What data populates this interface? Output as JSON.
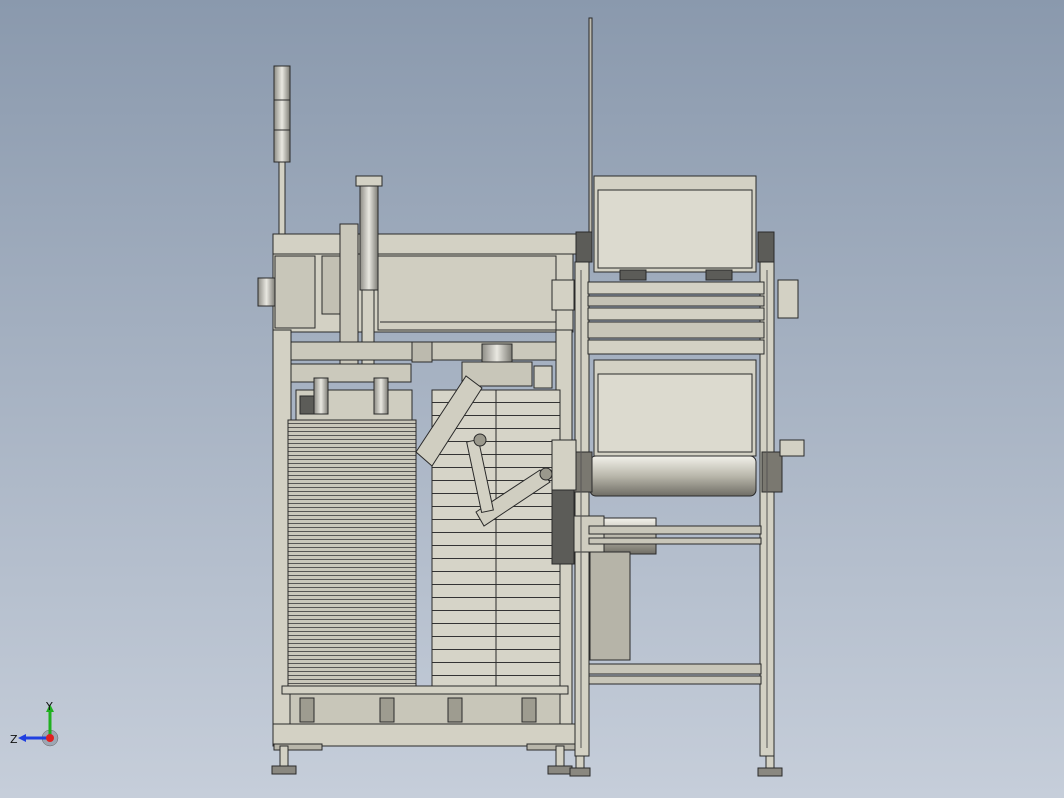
{
  "view": {
    "name": "cad-assembly-front-view",
    "colors": {
      "bg_top": "#8a99ad",
      "bg_bottom": "#c3cbd8",
      "metal": "#d3d1c4",
      "metal_dark": "#a9a79b",
      "line": "#2a2a2a",
      "dark_part": "#5c5c58",
      "axis_x": "#e02020",
      "axis_y": "#20b020",
      "axis_z": "#2040e0"
    }
  },
  "triad": {
    "x_label": "",
    "y_label": "Y",
    "z_label": "Z"
  }
}
